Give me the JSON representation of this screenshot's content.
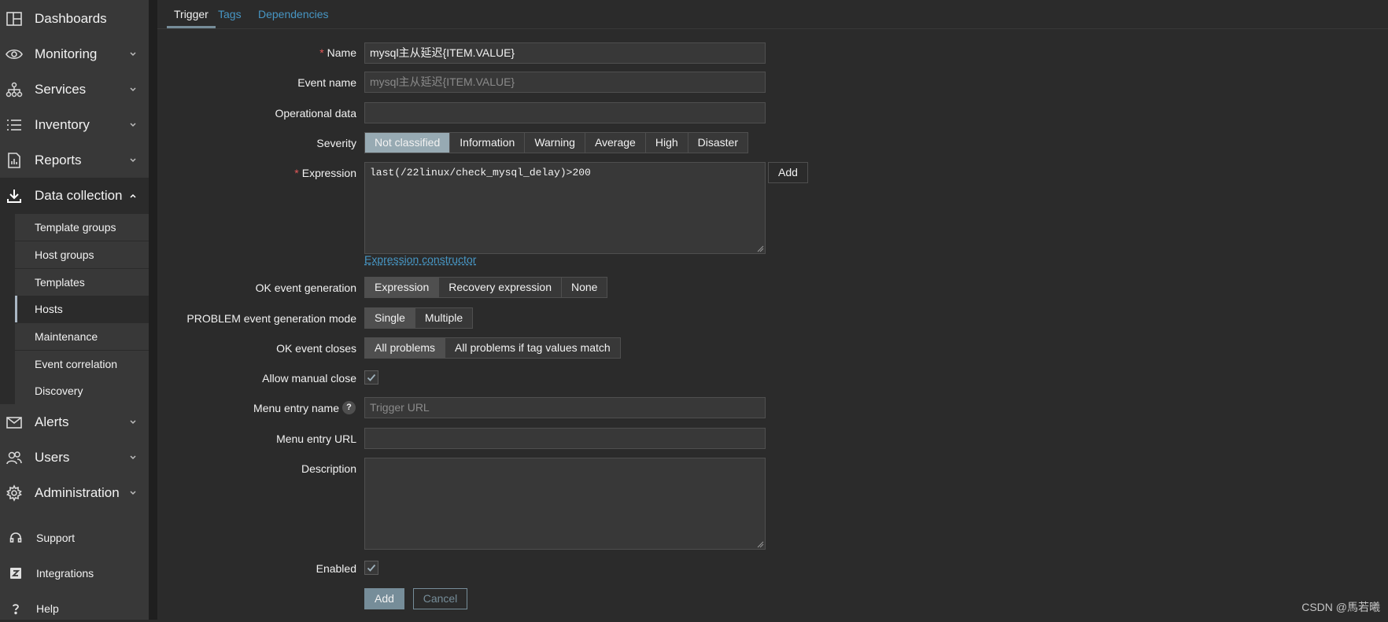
{
  "sidebar": {
    "menu": [
      {
        "label": "Dashboards",
        "icon": "dashboards-icon"
      },
      {
        "label": "Monitoring",
        "icon": "eye-icon"
      },
      {
        "label": "Services",
        "icon": "services-icon"
      },
      {
        "label": "Inventory",
        "icon": "list-icon"
      },
      {
        "label": "Reports",
        "icon": "reports-icon"
      },
      {
        "label": "Data collection",
        "icon": "download-icon"
      },
      {
        "label": "Alerts",
        "icon": "envelope-icon"
      },
      {
        "label": "Users",
        "icon": "users-icon"
      },
      {
        "label": "Administration",
        "icon": "gear-icon"
      }
    ],
    "submenu": [
      "Template groups",
      "Host groups",
      "Templates",
      "Hosts",
      "Maintenance",
      "Event correlation",
      "Discovery"
    ],
    "bottom": [
      {
        "label": "Support",
        "icon": "headset-icon"
      },
      {
        "label": "Integrations",
        "icon": "integrations-icon"
      },
      {
        "label": "Help",
        "icon": "help-icon"
      }
    ]
  },
  "tabs": [
    "Trigger",
    "Tags",
    "Dependencies"
  ],
  "form": {
    "name": {
      "label": "Name",
      "value": "mysql主从延迟{ITEM.VALUE}"
    },
    "event_name": {
      "label": "Event name",
      "placeholder": "mysql主从延迟{ITEM.VALUE}"
    },
    "operational_data": {
      "label": "Operational data",
      "value": ""
    },
    "severity": {
      "label": "Severity",
      "options": [
        "Not classified",
        "Information",
        "Warning",
        "Average",
        "High",
        "Disaster"
      ],
      "selected": "Not classified"
    },
    "expression": {
      "label": "Expression",
      "value": "last(/22linux/check_mysql_delay)>200",
      "add_button": "Add",
      "constructor_link": "Expression constructor"
    },
    "ok_event_generation": {
      "label": "OK event generation",
      "options": [
        "Expression",
        "Recovery expression",
        "None"
      ],
      "selected": "Expression"
    },
    "problem_mode": {
      "label": "PROBLEM event generation mode",
      "options": [
        "Single",
        "Multiple"
      ],
      "selected": "Single"
    },
    "ok_event_closes": {
      "label": "OK event closes",
      "options": [
        "All problems",
        "All problems if tag values match"
      ],
      "selected": "All problems"
    },
    "allow_manual_close": {
      "label": "Allow manual close",
      "checked": true
    },
    "menu_entry_name": {
      "label": "Menu entry name",
      "placeholder": "Trigger URL",
      "help": "?"
    },
    "menu_entry_url": {
      "label": "Menu entry URL",
      "value": ""
    },
    "description": {
      "label": "Description",
      "value": ""
    },
    "enabled": {
      "label": "Enabled",
      "checked": true
    },
    "add_button": "Add",
    "cancel_button": "Cancel"
  },
  "watermark": "CSDN @馬若曦"
}
